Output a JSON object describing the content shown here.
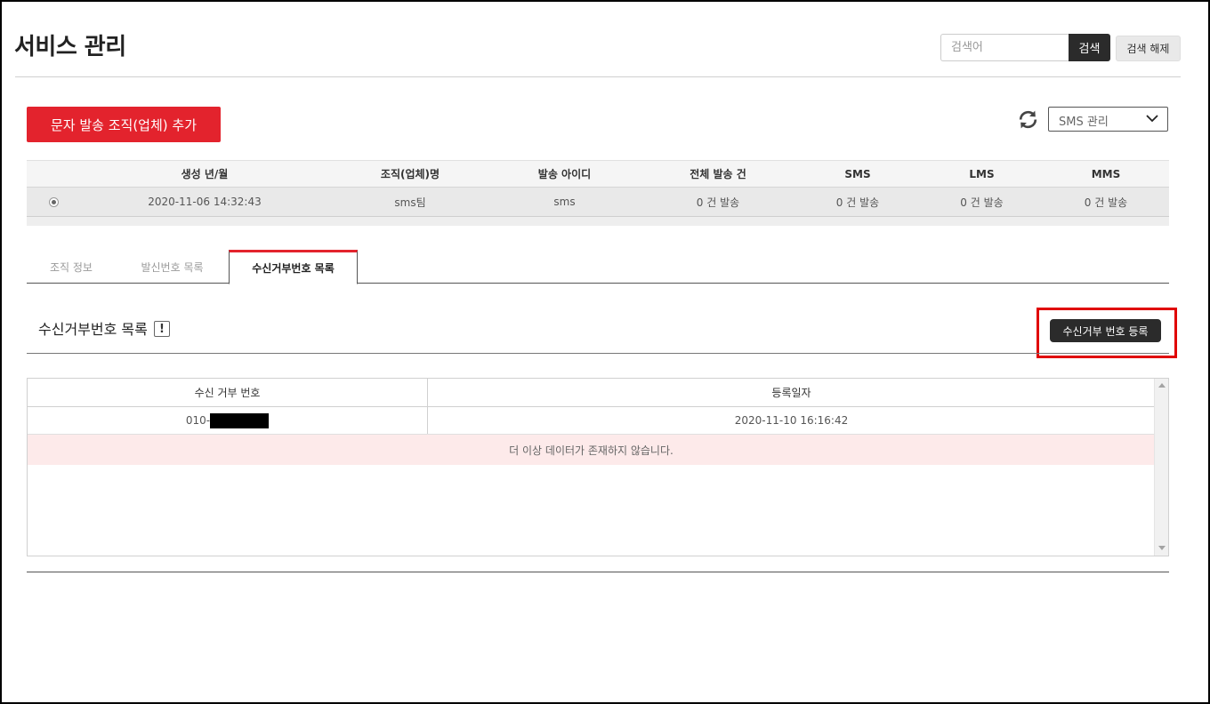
{
  "header": {
    "title": "서비스 관리",
    "search_placeholder": "검색어",
    "search_button": "검색",
    "reset_button": "검색 해제"
  },
  "toolbar": {
    "add_button": "문자 발송 조직(업체) 추가",
    "select_value": "SMS 관리"
  },
  "org_table": {
    "columns": [
      "생성 년/월",
      "조직(업체)명",
      "발송 아이디",
      "전체 발송 건",
      "SMS",
      "LMS",
      "MMS"
    ],
    "rows": [
      {
        "created": "2020-11-06 14:32:43",
        "org_name": "sms팀",
        "sender_id": "sms",
        "total": "0 건 발송",
        "sms": "0 건 발송",
        "lms": "0 건 발송",
        "mms": "0 건 발송"
      }
    ]
  },
  "tabs": [
    {
      "label": "조직 정보",
      "active": false
    },
    {
      "label": "발신번호 목록",
      "active": false
    },
    {
      "label": "수신거부번호 목록",
      "active": true
    }
  ],
  "section": {
    "title": "수신거부번호 목록",
    "info_mark": "!",
    "register_button": "수신거부 번호 등록"
  },
  "reject_table": {
    "columns": [
      "수신 거부 번호",
      "등록일자"
    ],
    "rows": [
      {
        "number_prefix": "010-",
        "date": "2020-11-10 16:16:42"
      }
    ],
    "no_more_message": "더 이상 데이터가 존재하지 않습니다."
  },
  "colors": {
    "accent_red": "#e3232d",
    "dark_button": "#2b2b2b",
    "highlight_border": "#e00000",
    "no_more_bg": "#fdeaea"
  },
  "icons": [
    "refresh-icon",
    "chevron-down-icon",
    "exclamation-icon",
    "radio-icon",
    "scroll-up-icon",
    "scroll-down-icon"
  ]
}
